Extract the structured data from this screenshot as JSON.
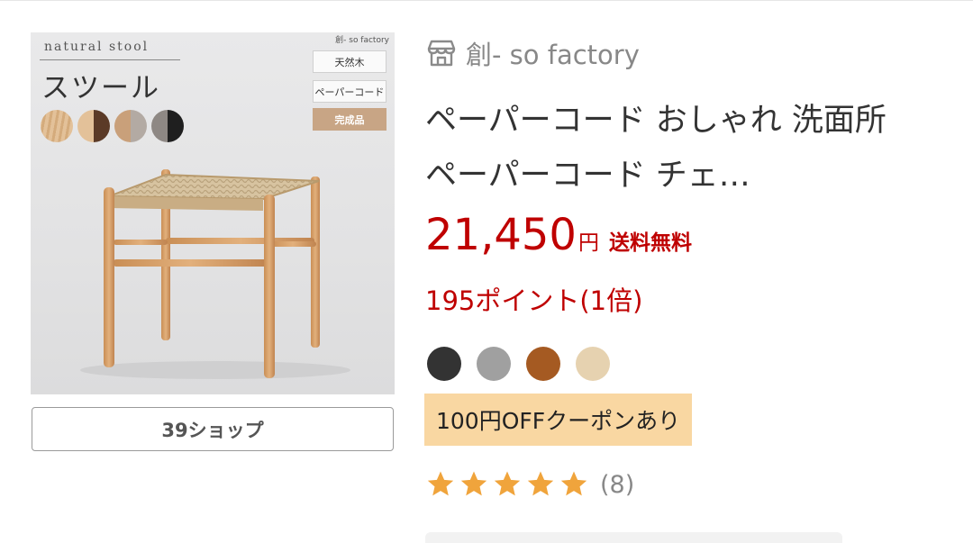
{
  "product_image": {
    "subtitle": "natural stool",
    "title": "スツール",
    "brand": "創- so factory",
    "tags": [
      "天然木",
      "ペーパーコード",
      "完成品"
    ]
  },
  "shop_button": {
    "label": "39ショップ"
  },
  "shop": {
    "name": "創- so factory",
    "icon": "store-icon"
  },
  "product": {
    "title": "ペーパーコード おしゃれ 洗面所 ペーパーコード チェ…",
    "price": "21,450",
    "price_unit": "円",
    "shipping": "送料無料",
    "points": "195ポイント(1倍)"
  },
  "colors": [
    "#333333",
    "#a0a0a0",
    "#a55a22",
    "#e6d2b0"
  ],
  "coupon": {
    "label": "100円OFFクーポンあり"
  },
  "rating": {
    "stars": 5,
    "review_count": "(8)",
    "star_color": "#f0a43c"
  },
  "accent": {
    "price_red": "#bf0000",
    "coupon_bg": "#f9d7a2"
  }
}
